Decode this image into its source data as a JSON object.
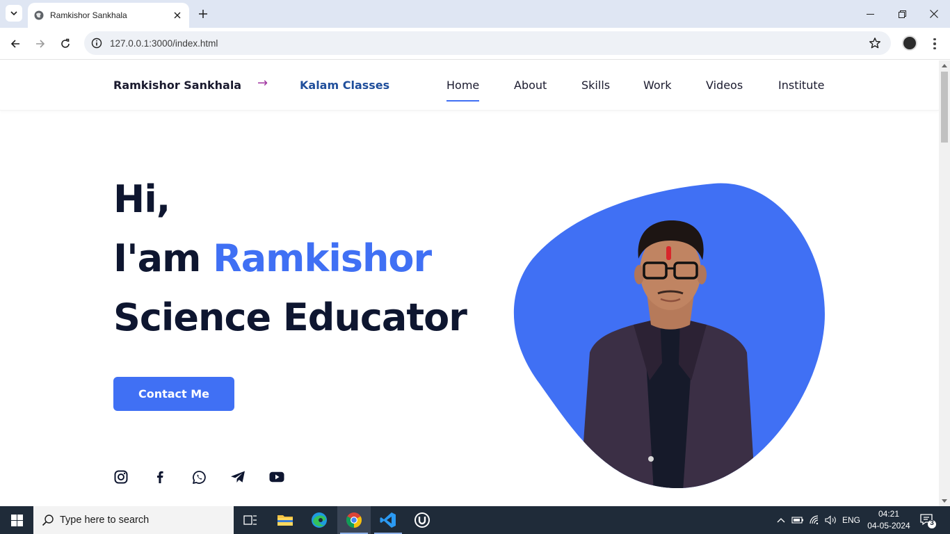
{
  "browser": {
    "tab_title": "Ramkishor Sankhala",
    "url": "127.0.0.1:3000/index.html"
  },
  "site": {
    "brand": "Ramkishor Sankhala",
    "brand_arrow": "→",
    "brand_link": "Kalam Classes",
    "nav": [
      "Home",
      "About",
      "Skills",
      "Work",
      "Videos",
      "Institute"
    ],
    "active_nav": "Home",
    "hero": {
      "greeting": "Hi,",
      "intro": "I'am ",
      "name": "Ramkishor",
      "role": "Science Educator"
    },
    "contact_button": "Contact Me",
    "socials": [
      "instagram-icon",
      "facebook-icon",
      "whatsapp-icon",
      "telegram-icon",
      "youtube-icon"
    ],
    "accent_color": "#4070f4",
    "text_color": "#0e1630"
  },
  "taskbar": {
    "search_placeholder": "Type here to search",
    "apps": [
      "task-view-icon",
      "file-explorer-icon",
      "edge-icon",
      "chrome-icon",
      "vscode-icon",
      "app-u-icon"
    ],
    "language": "ENG",
    "time": "04:21",
    "date": "04-05-2024",
    "notification_count": "3"
  }
}
